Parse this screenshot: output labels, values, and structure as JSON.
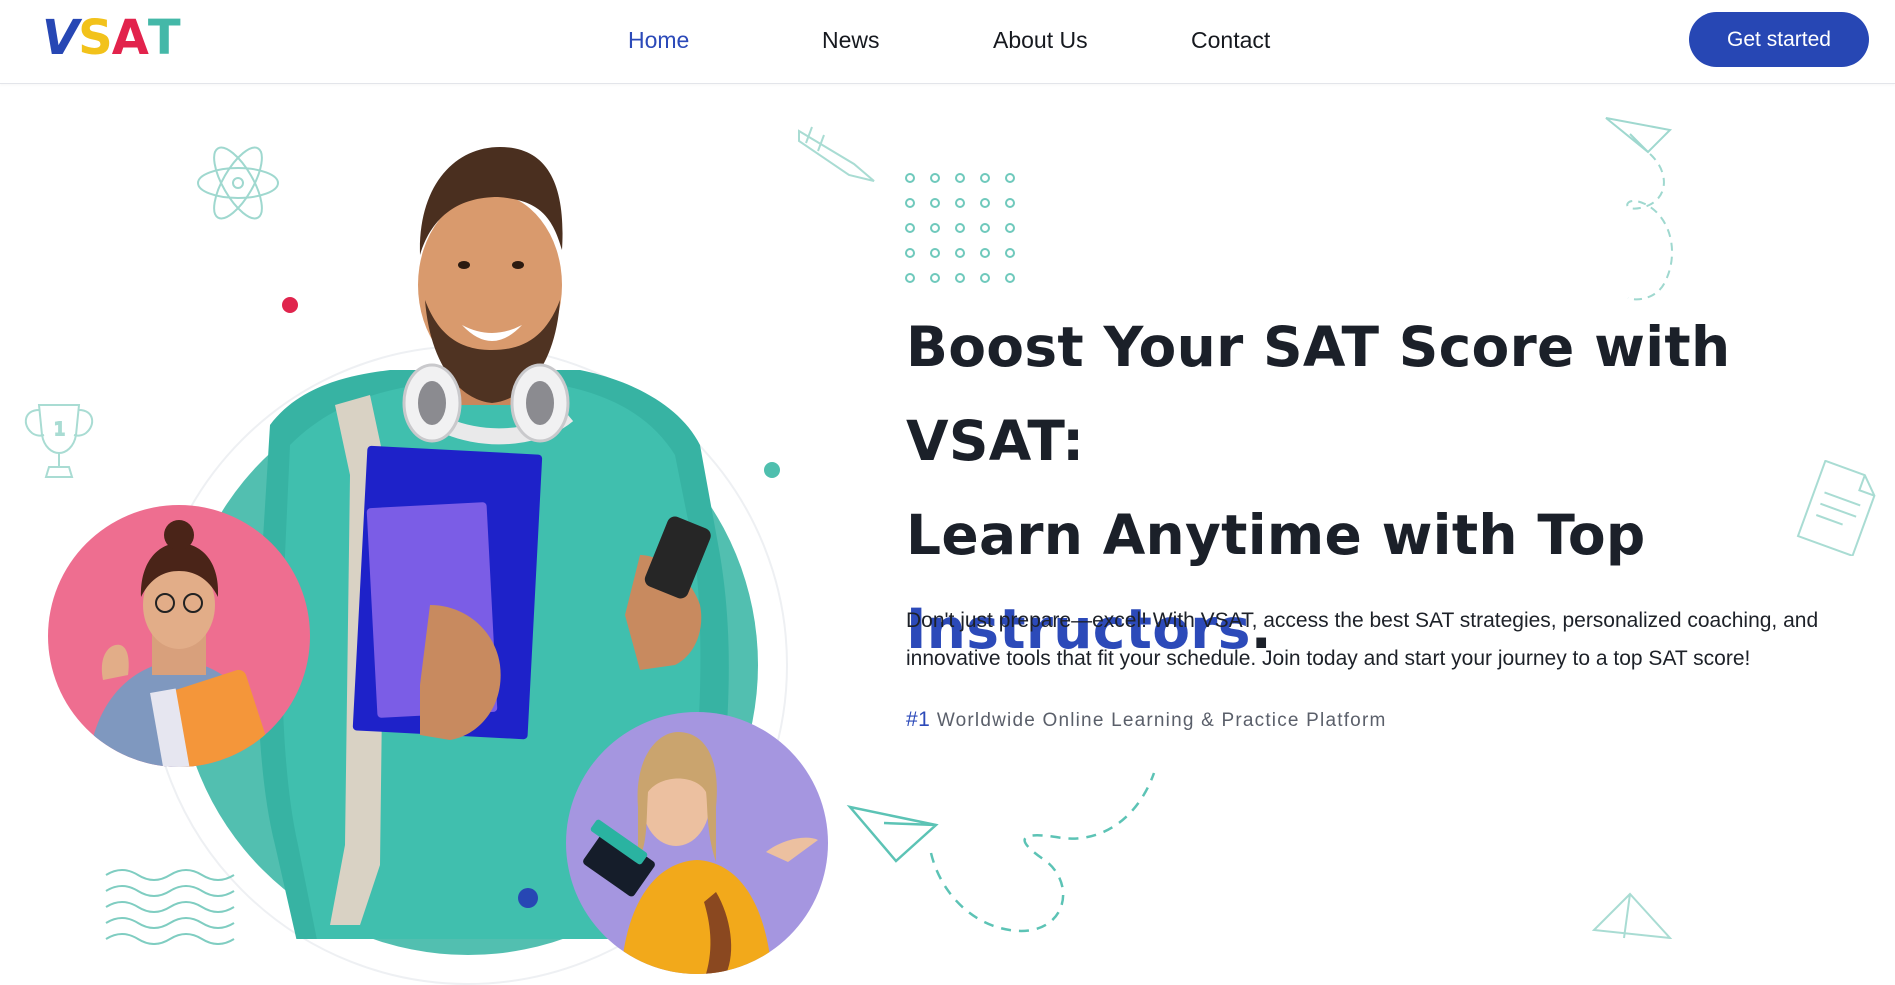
{
  "header": {
    "logo": {
      "letters": [
        "V",
        "S",
        "A",
        "T"
      ],
      "colors": [
        "#2747b4",
        "#f2c21b",
        "#e2234c",
        "#44b8a8"
      ]
    },
    "nav": [
      {
        "label": "Home",
        "active": true
      },
      {
        "label": "News",
        "active": false
      },
      {
        "label": "About Us",
        "active": false
      },
      {
        "label": "Contact",
        "active": false
      }
    ],
    "cta_label": "Get started"
  },
  "hero": {
    "title_line_1": "Boost Your SAT Score with VSAT:",
    "title_line_2": "Learn Anytime with Top",
    "title_accent": "Instructors",
    "title_end": ".",
    "subtitle": "Don't just prepare—excel! With VSAT, access the best SAT strategies, personalized coaching, and innovative tools that fit your schedule. Join today and start your journey to a top SAT score!",
    "tagline_number": "#1",
    "tagline_text": "Worldwide Online Learning & Practice Platform"
  },
  "colors": {
    "brand_blue": "#2c4ab9",
    "teal": "#52bfb0",
    "pink": "#ee6e90",
    "lavender": "#a596e0",
    "red_dot": "#e0254d",
    "text_dark": "#1b2029"
  },
  "icons": [
    "atom-icon",
    "rocket-icon",
    "trophy-icon",
    "paper-plane-icon",
    "document-icon",
    "wave-lines-icon",
    "dot-grid-icon"
  ]
}
